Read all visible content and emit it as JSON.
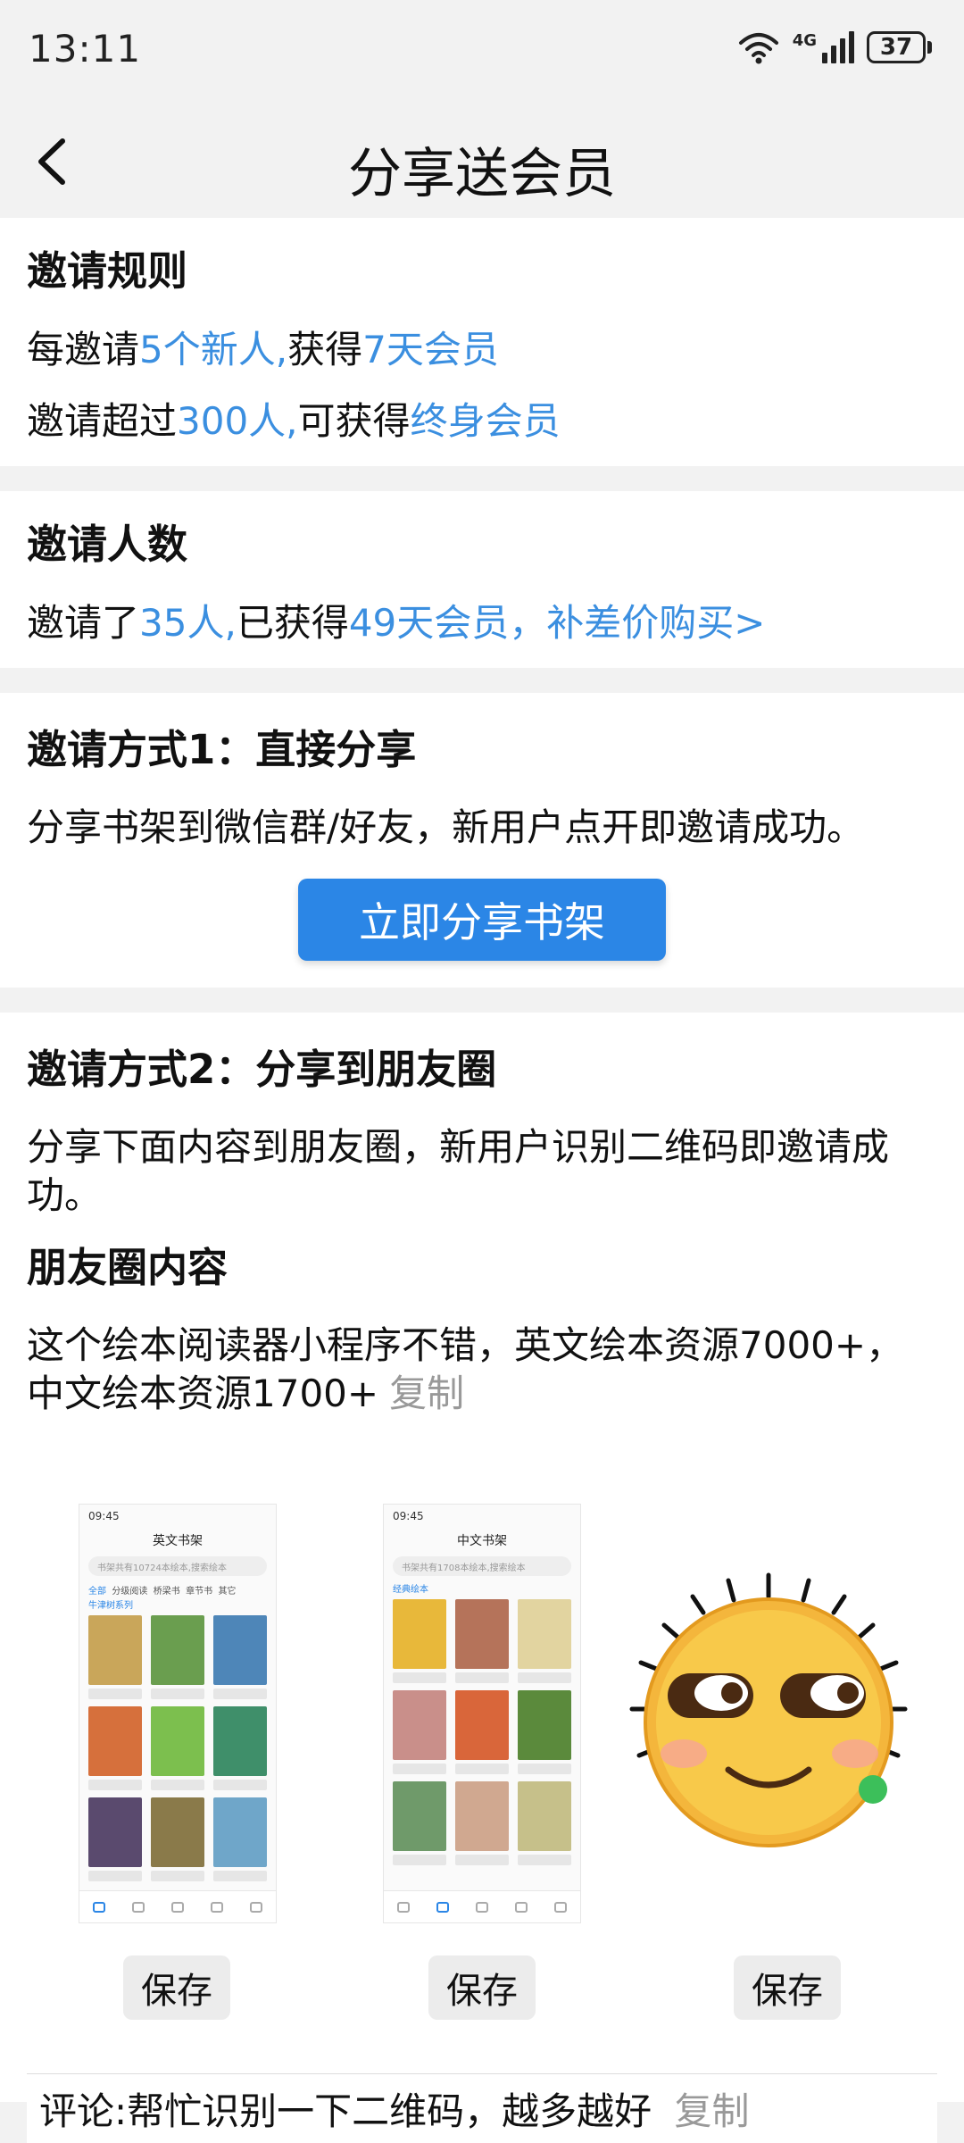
{
  "status": {
    "time": "13:11",
    "network": "4G",
    "battery": "37"
  },
  "nav": {
    "title": "分享送会员"
  },
  "rules": {
    "heading": "邀请规则",
    "line1": {
      "a": "每邀请",
      "b": "5个新人,",
      "c": "获得",
      "d": "7天会员"
    },
    "line2": {
      "a": "邀请超过",
      "b": "300人,",
      "c": "可获得",
      "d": "终身会员"
    }
  },
  "count": {
    "heading": "邀请人数",
    "line": {
      "a": "邀请了",
      "b": "35人,",
      "c": "已获得",
      "d": "49天会员，",
      "e": "补差价购买>"
    }
  },
  "method1": {
    "heading": "邀请方式1：直接分享",
    "desc": "分享书架到微信群/好友，新用户点开即邀请成功。",
    "button": "立即分享书架"
  },
  "method2": {
    "heading": "邀请方式2：分享到朋友圈",
    "desc": "分享下面内容到朋友圈，新用户识别二维码即邀请成功。",
    "moments_heading": "朋友圈内容",
    "moments_text": "这个绘本阅读器小程序不错，英文绘本资源7000+，中文绘本资源1700+",
    "copy": "复制",
    "shots": [
      {
        "time": "09:45",
        "title": "英文书架",
        "search": "书架共有10724本绘本,搜索绘本",
        "tabs": [
          "全部",
          "分级阅读",
          "桥梁书",
          "章节书",
          "其它"
        ],
        "sub": "牛津树系列"
      },
      {
        "time": "09:45",
        "title": "中文书架",
        "search": "书架共有1708本绘本,搜索绘本",
        "tabs": [],
        "sub": "经典绘本"
      }
    ],
    "save_labels": [
      "保存",
      "保存",
      "保存"
    ]
  },
  "comment": {
    "text": "评论:帮忙识别一下二维码，越多越好",
    "copy": "复制"
  },
  "colors": {
    "accent": "#3b8fe0",
    "button": "#2b86e6",
    "background": "#f2f2f2"
  },
  "icons": [
    "back-icon",
    "wifi-icon",
    "signal-icon",
    "battery-icon",
    "emoji-icon"
  ]
}
